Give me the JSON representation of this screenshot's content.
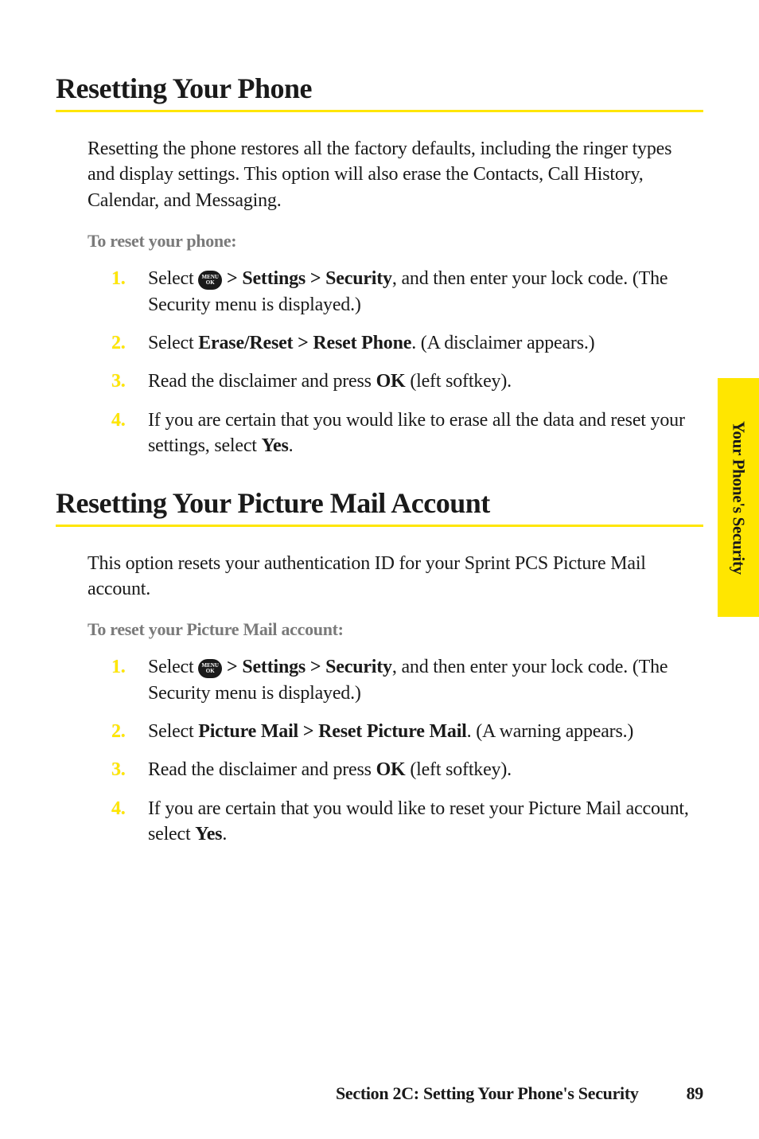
{
  "sideTab": "Your Phone's Security",
  "section1": {
    "heading": "Resetting Your Phone",
    "intro": "Resetting the phone restores all the factory defaults, including the ringer types and display settings. This option will also erase the Contacts, Call History, Calendar, and Messaging.",
    "sub": "To reset your phone:",
    "steps": {
      "n1": "1.",
      "s1_pre": "Select ",
      "s1_icon_top": "MENU",
      "s1_icon_bot": "OK",
      "s1_bold": " > Settings > Security",
      "s1_post": ", and then enter your lock code. (The Security menu is displayed.)",
      "n2": "2.",
      "s2_pre": "Select ",
      "s2_bold": "Erase/Reset > Reset Phone",
      "s2_post": ". (A disclaimer appears.)",
      "n3": "3.",
      "s3_pre": "Read the disclaimer and press ",
      "s3_bold": "OK",
      "s3_post": " (left softkey).",
      "n4": "4.",
      "s4_pre": "If you are certain that you would like to erase all the data and reset your settings, select ",
      "s4_bold": "Yes",
      "s4_post": "."
    }
  },
  "section2": {
    "heading": "Resetting Your Picture Mail Account",
    "intro": "This option resets your authentication ID for your Sprint PCS Picture Mail account.",
    "sub": "To reset your Picture Mail account:",
    "steps": {
      "n1": "1.",
      "s1_pre": "Select ",
      "s1_icon_top": "MENU",
      "s1_icon_bot": "OK",
      "s1_bold": " > Settings > Security",
      "s1_post": ", and then enter your lock code. (The Security menu is displayed.)",
      "n2": "2.",
      "s2_pre": "Select ",
      "s2_bold": "Picture Mail > Reset Picture Mail",
      "s2_post": ". (A warning appears.)",
      "n3": "3.",
      "s3_pre": "Read the disclaimer and press ",
      "s3_bold": "OK",
      "s3_post": " (left softkey).",
      "n4": "4.",
      "s4_pre": "If you are certain that you would like to reset your Picture Mail account, select ",
      "s4_bold": "Yes",
      "s4_post": "."
    }
  },
  "footer": {
    "title": "Section 2C: Setting Your Phone's Security",
    "page": "89"
  }
}
